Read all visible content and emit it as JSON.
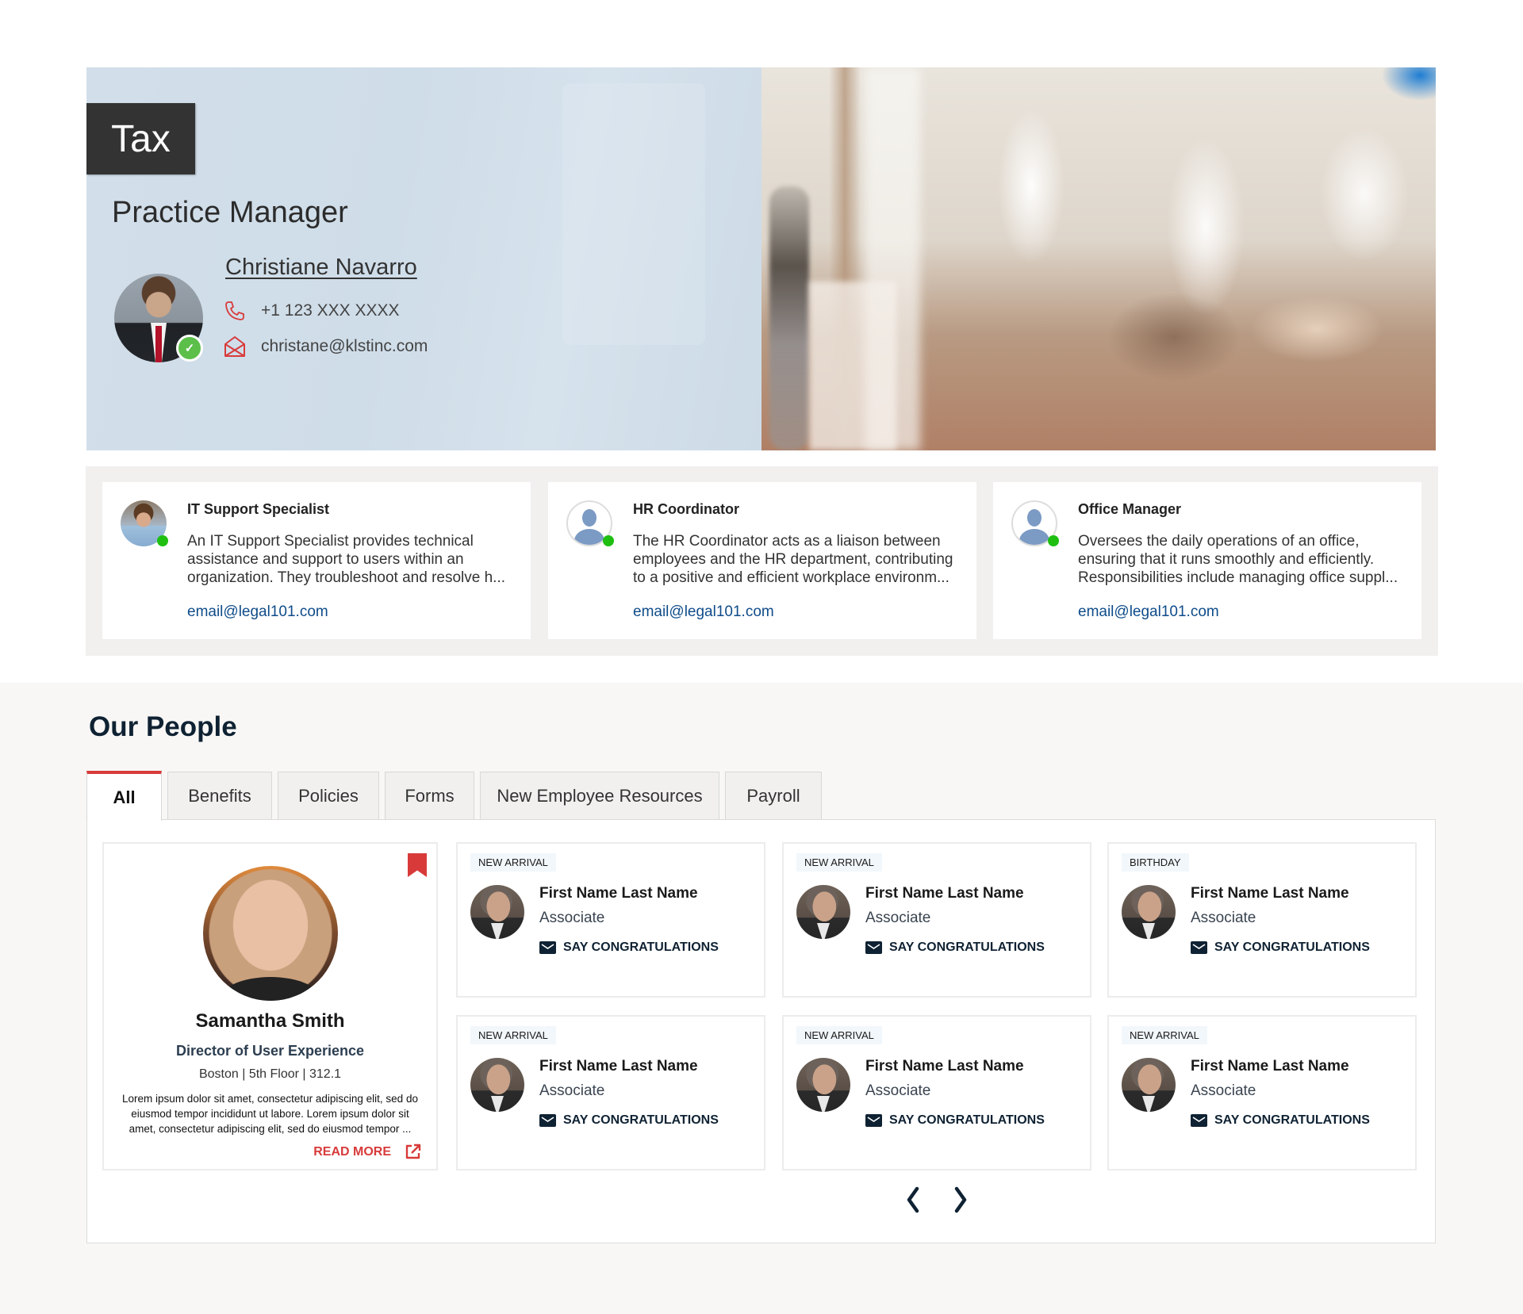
{
  "hero": {
    "department": "Tax",
    "title": "Practice Manager",
    "name": "Christiane Navarro",
    "phone": "+1 123 XXX XXXX",
    "email": "christane@klstinc.com",
    "status": "verified",
    "accent_color": "#d83a3a"
  },
  "roles": [
    {
      "title": "IT Support Specialist",
      "desc_lines": [
        "An IT Support Specialist provides technical",
        "assistance and support to users within an",
        "organization. They troubleshoot and resolve h..."
      ],
      "email": "email@legal101.com",
      "avatar": "photo",
      "online": true
    },
    {
      "title": "HR Coordinator",
      "desc_lines": [
        "The HR Coordinator acts as a liaison between",
        "employees and the HR department, contributing",
        "to a positive and efficient workplace environm..."
      ],
      "email": "email@legal101.com",
      "avatar": "placeholder",
      "online": true
    },
    {
      "title": "Office Manager",
      "desc_lines": [
        "Oversees the daily operations of an office,",
        "ensuring that it runs smoothly and efficiently.",
        "Responsibilities include managing office suppl..."
      ],
      "email": "email@legal101.com",
      "avatar": "placeholder",
      "online": true
    }
  ],
  "people": {
    "heading": "Our People",
    "tabs": [
      {
        "label": "All",
        "active": true
      },
      {
        "label": "Benefits",
        "active": false
      },
      {
        "label": "Policies",
        "active": false
      },
      {
        "label": "Forms",
        "active": false
      },
      {
        "label": "New Employee Resources",
        "active": false
      },
      {
        "label": "Payroll",
        "active": false
      }
    ],
    "featured": {
      "name": "Samantha Smith",
      "role": "Director of User Experience",
      "location": "Boston | 5th Floor | 312.1",
      "bio_lines": [
        "Lorem ipsum dolor sit amet, consectetur adipiscing elit, sed do",
        "eiusmod tempor incididunt ut labore. Lorem ipsum dolor sit",
        "amet, consectetur adipiscing elit, sed do eiusmod tempor ..."
      ],
      "read_more": "READ MORE",
      "bookmarked": true
    },
    "cards": [
      {
        "badge": "NEW ARRIVAL",
        "name": "First Name Last Name",
        "role": "Associate",
        "action": "SAY CONGRATULATIONS"
      },
      {
        "badge": "NEW ARRIVAL",
        "name": "First Name Last Name",
        "role": "Associate",
        "action": "SAY CONGRATULATIONS"
      },
      {
        "badge": "BIRTHDAY",
        "name": "First Name Last Name",
        "role": "Associate",
        "action": "SAY CONGRATULATIONS"
      },
      {
        "badge": "NEW ARRIVAL",
        "name": "First Name Last Name",
        "role": "Associate",
        "action": "SAY CONGRATULATIONS"
      },
      {
        "badge": "NEW ARRIVAL",
        "name": "First Name Last Name",
        "role": "Associate",
        "action": "SAY CONGRATULATIONS"
      },
      {
        "badge": "NEW ARRIVAL",
        "name": "First Name Last Name",
        "role": "Associate",
        "action": "SAY CONGRATULATIONS"
      }
    ],
    "pager": {
      "prev_icon": "chevron-left-icon",
      "next_icon": "chevron-right-icon"
    }
  }
}
